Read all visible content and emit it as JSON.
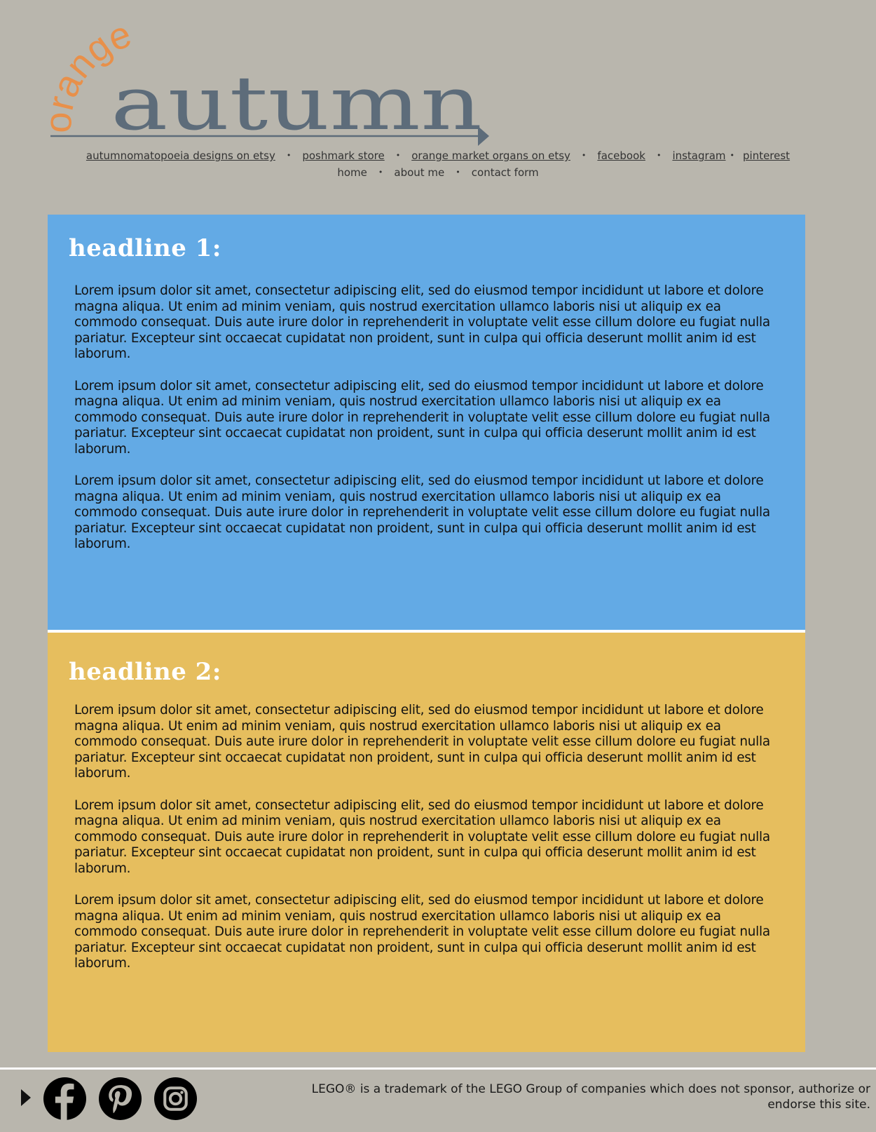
{
  "logo": {
    "small_word": "orange",
    "big_word": "autumn"
  },
  "nav": {
    "external_links": [
      {
        "label": "autumnomatopoeia designs on etsy"
      },
      {
        "label": "poshmark store"
      },
      {
        "label": "orange market organs on etsy"
      },
      {
        "label": "facebook"
      },
      {
        "label": "instagram"
      },
      {
        "label": "pinterest"
      }
    ],
    "site_links": [
      {
        "label": "home"
      },
      {
        "label": "about me"
      },
      {
        "label": "contact form"
      }
    ],
    "separator": "•"
  },
  "sections": [
    {
      "headline": "headline 1:",
      "paragraphs": [
        "Lorem ipsum dolor sit amet, consectetur adipiscing elit, sed do eiusmod tempor incididunt ut labore et dolore magna aliqua. Ut enim ad minim veniam, quis nostrud exercitation ullamco laboris nisi ut aliquip ex ea commodo consequat. Duis aute irure dolor in reprehenderit in voluptate velit esse cillum dolore eu fugiat nulla pariatur. Excepteur sint occaecat cupidatat non proident, sunt in culpa qui officia deserunt mollit anim id est laborum.",
        "Lorem ipsum dolor sit amet, consectetur adipiscing elit, sed do eiusmod tempor incididunt ut labore et dolore magna aliqua. Ut enim ad minim veniam, quis nostrud exercitation ullamco laboris nisi ut aliquip ex ea commodo consequat. Duis aute irure dolor in reprehenderit in voluptate velit esse cillum dolore eu fugiat nulla pariatur. Excepteur sint occaecat cupidatat non proident, sunt in culpa qui officia deserunt mollit anim id est laborum.",
        "Lorem ipsum dolor sit amet, consectetur adipiscing elit, sed do eiusmod tempor incididunt ut labore et dolore magna aliqua. Ut enim ad minim veniam, quis nostrud exercitation ullamco laboris nisi ut aliquip ex ea commodo consequat. Duis aute irure dolor in reprehenderit in voluptate velit esse cillum dolore eu fugiat nulla pariatur. Excepteur sint occaecat cupidatat non proident, sunt in culpa qui officia deserunt mollit anim id est laborum."
      ]
    },
    {
      "headline": "headline 2:",
      "paragraphs": [
        "Lorem ipsum dolor sit amet, consectetur adipiscing elit, sed do eiusmod tempor incididunt ut labore et dolore magna aliqua. Ut enim ad minim veniam, quis nostrud exercitation ullamco laboris nisi ut aliquip ex ea commodo consequat. Duis aute irure dolor in reprehenderit in voluptate velit esse cillum dolore eu fugiat nulla pariatur. Excepteur sint occaecat cupidatat non proident, sunt in culpa qui officia deserunt mollit anim id est laborum.",
        "Lorem ipsum dolor sit amet, consectetur adipiscing elit, sed do eiusmod tempor incididunt ut labore et dolore magna aliqua. Ut enim ad minim veniam, quis nostrud exercitation ullamco laboris nisi ut aliquip ex ea commodo consequat. Duis aute irure dolor in reprehenderit in voluptate velit esse cillum dolore eu fugiat nulla pariatur. Excepteur sint occaecat cupidatat non proident, sunt in culpa qui officia deserunt mollit anim id est laborum.",
        "Lorem ipsum dolor sit amet, consectetur adipiscing elit, sed do eiusmod tempor incididunt ut labore et dolore magna aliqua. Ut enim ad minim veniam, quis nostrud exercitation ullamco laboris nisi ut aliquip ex ea commodo consequat. Duis aute irure dolor in reprehenderit in voluptate velit esse cillum dolore eu fugiat nulla pariatur. Excepteur sint occaecat cupidatat non proident, sunt in culpa qui officia deserunt mollit anim id est laborum."
      ]
    }
  ],
  "footer": {
    "social_icons": [
      "facebook-icon",
      "pinterest-icon",
      "instagram-icon"
    ],
    "trademark_line1": "LEGO® is a trademark of the LEGO Group of companies which does not sponsor, authorize or",
    "trademark_line2": "endorse this site."
  },
  "colors": {
    "page_bg": "#b9b6ad",
    "panel_1": "#63aae5",
    "panel_2": "#e6be5e",
    "logo_orange": "#e8904a",
    "logo_slate": "#5d6c7a"
  }
}
